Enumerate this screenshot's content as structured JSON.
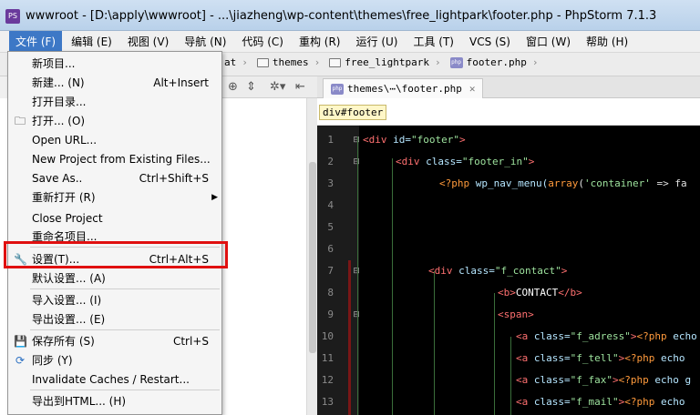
{
  "window": {
    "title": "wwwroot - [D:\\apply\\wwwroot] - ...\\jiazheng\\wp-content\\themes\\free_lightpark\\footer.php - PhpStorm 7.1.3",
    "app_icon": "PS"
  },
  "menubar": {
    "items": [
      "文件 (F)",
      "编辑 (E)",
      "视图 (V)",
      "导航 (N)",
      "代码 (C)",
      "重构 (R)",
      "运行 (U)",
      "工具 (T)",
      "VCS (S)",
      "窗口 (W)",
      "帮助 (H)"
    ]
  },
  "breadcrumbs": {
    "partial": "at",
    "items": [
      "themes",
      "free_lightpark",
      "footer.php"
    ]
  },
  "editor": {
    "tab_label": "themes\\⋯\\footer.php",
    "tab_icon": "php",
    "tag_path": "div#footer",
    "line_numbers": [
      "1",
      "2",
      "3",
      "4",
      "5",
      "6",
      "7",
      "8",
      "9",
      "10",
      "11",
      "12",
      "13"
    ]
  },
  "file_menu": {
    "items": [
      {
        "label": "新项目...",
        "shortcut": ""
      },
      {
        "label": "新建... (N)",
        "shortcut": "Alt+Insert"
      },
      {
        "label": "打开目录...",
        "shortcut": ""
      },
      {
        "label": "打开... (O)",
        "shortcut": ""
      },
      {
        "label": "Open URL...",
        "shortcut": ""
      },
      {
        "label": "New Project from Existing Files...",
        "shortcut": ""
      },
      {
        "label": "Save As..",
        "shortcut": "Ctrl+Shift+S"
      },
      {
        "label": "重新打开 (R)",
        "shortcut": ""
      },
      {
        "label": "Close Project",
        "shortcut": ""
      },
      {
        "label": "重命名项目...",
        "shortcut": ""
      },
      {
        "label": "设置(T)...",
        "shortcut": "Ctrl+Alt+S"
      },
      {
        "label": "默认设置... (A)",
        "shortcut": ""
      },
      {
        "label": "导入设置... (I)",
        "shortcut": ""
      },
      {
        "label": "导出设置... (E)",
        "shortcut": ""
      },
      {
        "label": "保存所有 (S)",
        "shortcut": "Ctrl+S"
      },
      {
        "label": "同步 (Y)",
        "shortcut": ""
      },
      {
        "label": "Invalidate Caches / Restart...",
        "shortcut": ""
      },
      {
        "label": "导出到HTML... (H)",
        "shortcut": ""
      }
    ]
  },
  "code_lines": [
    {
      "html": "<span class='tag'>&lt;div</span> <span class='attr'>id=</span><span class='str'>\"footer\"</span><span class='tag'>&gt;</span>"
    },
    {
      "html": "<span class='tag'>&lt;div</span> <span class='attr'>class=</span><span class='str'>\"footer_in\"</span><span class='tag'>&gt;</span>"
    },
    {
      "html": "<span class='phpk'>&lt;?php</span> <span class='attr'>wp_nav_menu(</span><span class='phpk'>array</span>(<span class='str'>'container'</span> =&gt; fa"
    },
    {
      "html": ""
    },
    {
      "html": ""
    },
    {
      "html": ""
    },
    {
      "html": "<span class='tag'>&lt;div</span> <span class='attr'>class=</span><span class='str'>\"f_contact\"</span><span class='tag'>&gt;</span>"
    },
    {
      "html": "<span class='tag'>&lt;b&gt;</span><span class='txt'>CONTACT</span><span class='tag'>&lt;/b&gt;</span>"
    },
    {
      "html": "<span class='tag'>&lt;span&gt;</span>"
    },
    {
      "html": "<span class='tag'>&lt;a</span> <span class='attr'>class=</span><span class='str'>\"f_adress\"</span><span class='tag'>&gt;</span><span class='phpk'>&lt;?php</span> <span class='attr'>echo</span>"
    },
    {
      "html": "<span class='tag'>&lt;a</span> <span class='attr'>class=</span><span class='str'>\"f_tell\"</span><span class='tag'>&gt;</span><span class='phpk'>&lt;?php</span> <span class='attr'>echo</span>"
    },
    {
      "html": "<span class='tag'>&lt;a</span> <span class='attr'>class=</span><span class='str'>\"f_fax\"</span><span class='tag'>&gt;</span><span class='phpk'>&lt;?php</span> <span class='attr'>echo g</span>"
    },
    {
      "html": "<span class='tag'>&lt;a</span> <span class='attr'>class=</span><span class='str'>\"f_mail\"</span><span class='tag'>&gt;</span><span class='phpk'>&lt;?php</span> <span class='attr'>echo</span>"
    }
  ]
}
